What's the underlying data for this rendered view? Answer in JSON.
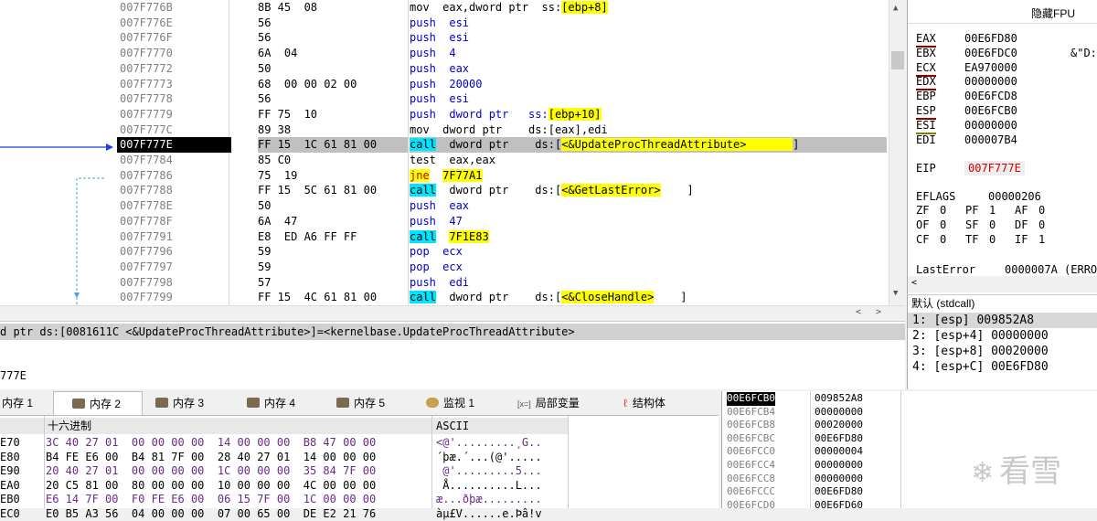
{
  "disasm": [
    {
      "addr": "007F776B",
      "bytes": "8B 45  08",
      "ins": [
        [
          "t",
          "mov  eax,dword ptr  ss:"
        ],
        [
          "hl",
          "[ebp+8]"
        ]
      ]
    },
    {
      "addr": "007F776E",
      "bytes": "56",
      "ins": [
        [
          "b",
          "push  esi"
        ]
      ]
    },
    {
      "addr": "007F776F",
      "bytes": "56",
      "ins": [
        [
          "b",
          "push  esi"
        ]
      ]
    },
    {
      "addr": "007F7770",
      "bytes": "6A  04",
      "ins": [
        [
          "b",
          "push  4"
        ]
      ]
    },
    {
      "addr": "007F7772",
      "bytes": "50",
      "ins": [
        [
          "b",
          "push  eax"
        ]
      ]
    },
    {
      "addr": "007F7773",
      "bytes": "68  00 00 02 00",
      "ins": [
        [
          "b",
          "push  20000"
        ]
      ]
    },
    {
      "addr": "007F7778",
      "bytes": "56",
      "ins": [
        [
          "b",
          "push  esi"
        ]
      ]
    },
    {
      "addr": "007F7779",
      "bytes": "FF 75  10",
      "ins": [
        [
          "b",
          "push  dword ptr   ss:"
        ],
        [
          "hl",
          "[ebp+10]"
        ]
      ]
    },
    {
      "addr": "007F777C",
      "bytes": "89 38",
      "ins": [
        [
          "t",
          "mov  dword ptr    ds:[eax],edi"
        ]
      ]
    },
    {
      "addr": "007F777E",
      "bytes": "FF 15  1C 61 81 00",
      "sel": true,
      "ins": [
        [
          "c",
          "call"
        ],
        [
          "t",
          "  dword ptr    ds:["
        ],
        [
          "hl",
          "<&UpdateProcThreadAttribute>       "
        ],
        [
          "t",
          "]"
        ]
      ]
    },
    {
      "addr": "007F7784",
      "bytes": "85 C0",
      "ins": [
        [
          "t",
          "test  eax,eax"
        ]
      ]
    },
    {
      "addr": "007F7786",
      "bytes": "75  19",
      "ins": [
        [
          "j",
          "jne"
        ],
        [
          "t",
          "  "
        ],
        [
          "hl",
          "7F77A1"
        ]
      ]
    },
    {
      "addr": "007F7788",
      "bytes": "FF 15  5C 61 81 00",
      "ins": [
        [
          "c",
          "call"
        ],
        [
          "t",
          "  dword ptr    ds:["
        ],
        [
          "hl",
          "<&GetLastError>"
        ],
        [
          "t",
          "    ]"
        ]
      ]
    },
    {
      "addr": "007F778E",
      "bytes": "50",
      "ins": [
        [
          "b",
          "push  eax"
        ]
      ]
    },
    {
      "addr": "007F778F",
      "bytes": "6A  47",
      "ins": [
        [
          "b",
          "push  47"
        ]
      ]
    },
    {
      "addr": "007F7791",
      "bytes": "E8  ED A6 FF FF",
      "ins": [
        [
          "c",
          "call"
        ],
        [
          "t",
          "  "
        ],
        [
          "hl",
          "7F1E83"
        ]
      ]
    },
    {
      "addr": "007F7796",
      "bytes": "59",
      "ins": [
        [
          "b",
          "pop  ecx"
        ]
      ]
    },
    {
      "addr": "007F7797",
      "bytes": "59",
      "ins": [
        [
          "b",
          "pop  ecx"
        ]
      ]
    },
    {
      "addr": "007F7798",
      "bytes": "57",
      "ins": [
        [
          "b",
          "push  edi"
        ]
      ]
    },
    {
      "addr": "007F7799",
      "bytes": "FF 15  4C 61 81 00",
      "ins": [
        [
          "c",
          "call"
        ],
        [
          "t",
          "  dword ptr    ds:["
        ],
        [
          "hl",
          "<&CloseHandle>"
        ],
        [
          "t",
          "    ]"
        ]
      ]
    }
  ],
  "info": {
    "line1": "d ptr ds:[0081611C <&UpdateProcThreadAttribute>]=<kernelbase.UpdateProcThreadAttribute>",
    "line2": "777E"
  },
  "fpu_header": "隐藏FPU",
  "registers": [
    {
      "name": "EAX",
      "value": "00E6FD80"
    },
    {
      "name": "EBX",
      "value": "00E6FDC0",
      "extra": "&\"D:/"
    },
    {
      "name": "ECX",
      "value": "EA970000"
    },
    {
      "name": "EDX",
      "value": "00000000"
    },
    {
      "name": "EBP",
      "value": "00E6FCD8"
    },
    {
      "name": "ESP",
      "value": "00E6FCB0"
    },
    {
      "name": "ESI",
      "value": "00000000"
    },
    {
      "name": "EDI",
      "value": "000007B4"
    }
  ],
  "eip": {
    "name": "EIP",
    "value": "007F777E"
  },
  "eflags": {
    "name": "EFLAGS",
    "value": "00000206"
  },
  "flags": [
    [
      "ZF",
      "0",
      "PF",
      "1",
      "AF",
      "0"
    ],
    [
      "OF",
      "0",
      "SF",
      "0",
      "DF",
      "0"
    ],
    [
      "CF",
      "0",
      "TF",
      "0",
      "IF",
      "1"
    ]
  ],
  "lasterror": {
    "name": "LastError",
    "value": "0000007A (ERROR"
  },
  "callconv": "默认 (stdcall)",
  "stackargs": [
    "1: [esp] 009852A8",
    "2: [esp+4] 00000000",
    "3: [esp+8] 00020000",
    "4: [esp+C] 00E6FD80"
  ],
  "tabs": [
    "内存 1",
    "内存 2",
    "内存 3",
    "内存 4",
    "内存 5",
    "监视 1",
    "局部变量",
    "结构体"
  ],
  "tab_icons": [
    "[x=]"
  ],
  "dump": {
    "col_hex": "十六进制",
    "col_ascii": "ASCII",
    "rows": [
      {
        "addr": "E70",
        "hex": "3C 40 27 01  00 00 00 00  14 00 00 00  B8 47 00 00",
        "ascii": "<@'.........¸G.."
      },
      {
        "addr": "E80",
        "hex": "B4 FE E6 00  B4 81 7F 00  28 40 27 01  14 00 00 00",
        "ascii": "´þæ.´...(@'....."
      },
      {
        "addr": "E90",
        "hex": "20 40 27 01  00 00 00 00  1C 00 00 00  35 84 7F 00",
        "ascii": " @'.........5..."
      },
      {
        "addr": "EA0",
        "hex": "20 C5 81 00  80 00 00 00  10 00 00 00  4C 00 00 00",
        "ascii": " Å..........L..."
      },
      {
        "addr": "EB0",
        "hex": "E6 14 7F 00  F0 FE E6 00  06 15 7F 00  1C 00 00 00",
        "ascii": "æ...ðþæ........."
      },
      {
        "addr": "EC0",
        "hex": "E0 B5 A3 56  04 00 00 00  07 00 65 00  DE E2 21 76",
        "ascii": "àµ£V......e.Þâ!v"
      }
    ]
  },
  "stack": [
    {
      "addr": "00E6FCB0",
      "value": "009852A8"
    },
    {
      "addr": "00E6FCB4",
      "value": "00000000"
    },
    {
      "addr": "00E6FCB8",
      "value": "00020000"
    },
    {
      "addr": "00E6FCBC",
      "value": "00E6FD80"
    },
    {
      "addr": "00E6FCC0",
      "value": "00000004"
    },
    {
      "addr": "00E6FCC4",
      "value": "00000000"
    },
    {
      "addr": "00E6FCC8",
      "value": "00000000"
    },
    {
      "addr": "00E6FCCC",
      "value": "00E6FD80"
    },
    {
      "addr": "00E6FCD0",
      "value": "00E6FD60"
    }
  ],
  "watermark": "看雪"
}
